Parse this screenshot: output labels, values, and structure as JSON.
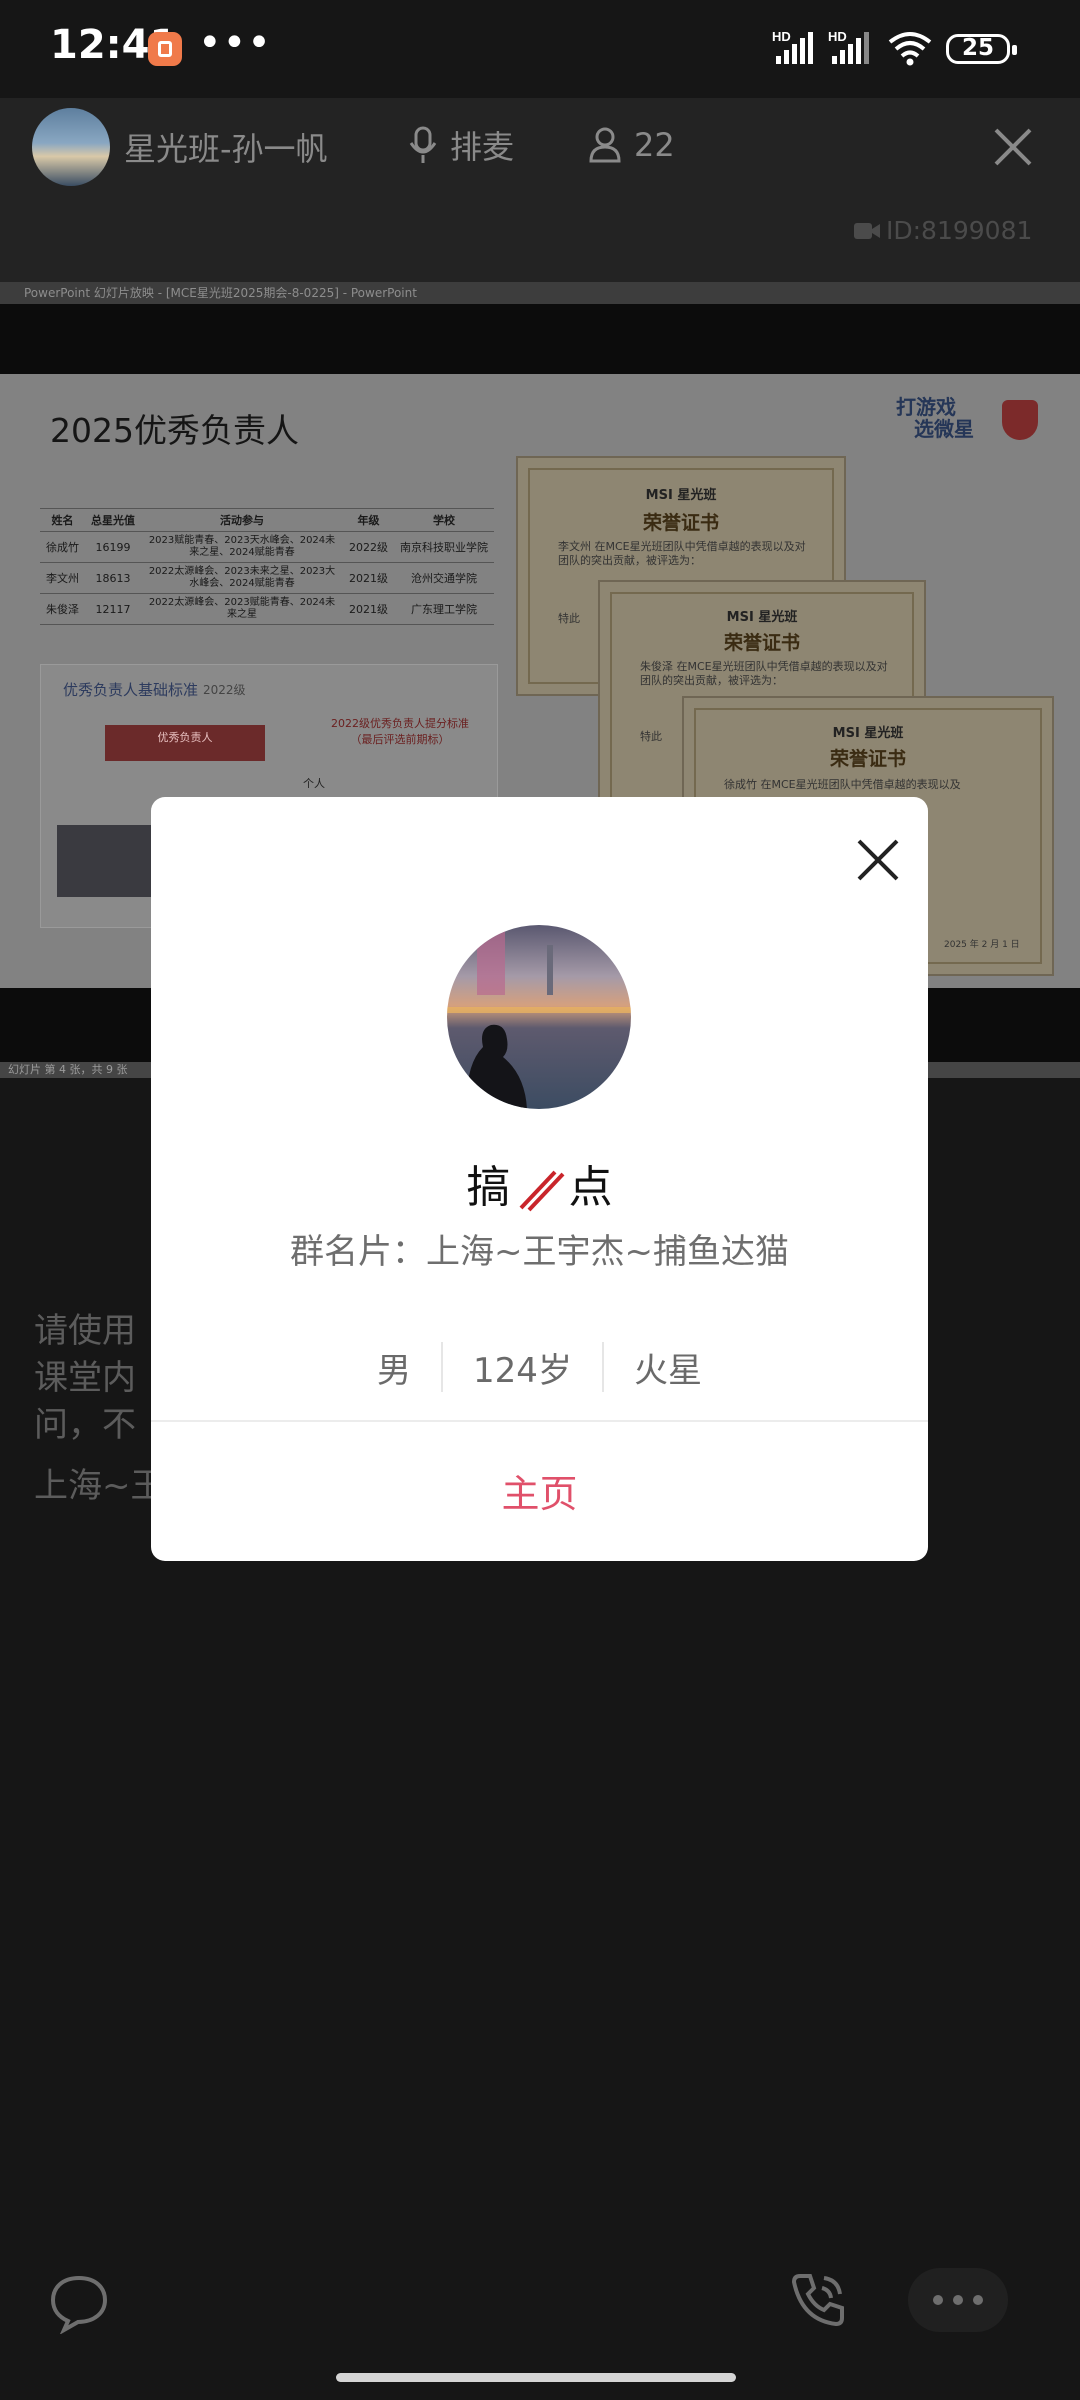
{
  "status_bar": {
    "time": "12:41",
    "dots": "•••",
    "hd1": "HD",
    "hd2": "HD",
    "battery": "25"
  },
  "header": {
    "host_name": "星光班-孙一帆",
    "queue_label": "排麦",
    "member_count": "22",
    "room_id": "ID:8199081"
  },
  "slide": {
    "window_title": "PowerPoint 幻灯片放映 - [MCE星光班2025期会-8-0225] - PowerPoint",
    "footer": "幻灯片 第 4 张，共 9 张",
    "title": "2025优秀负责人",
    "logo_text": [
      "打游戏",
      "选微星"
    ],
    "table": {
      "headers": [
        "姓名",
        "总星光值",
        "活动参与",
        "年级",
        "学校"
      ],
      "rows": [
        [
          "徐成竹",
          "16199",
          "2023赋能青春、2023天水峰会、2024未来之星、2024赋能青春",
          "2022级",
          "南京科技职业学院"
        ],
        [
          "李文州",
          "18613",
          "2022太源峰会、2023未来之星、2023大水峰会、2024赋能青春",
          "2021级",
          "沧州交通学院"
        ],
        [
          "朱俊泽",
          "12117",
          "2022太源峰会、2023赋能青春、2024未来之星",
          "2021级",
          "广东理工学院"
        ]
      ]
    },
    "criteria_title": "优秀负责人基础标准",
    "criteria_year": "2022级",
    "criteria_badge": "优秀负责人",
    "criteria_subtitle": "2022级优秀负责人提分标准",
    "criteria_subtitle2": "（最后评选前期标）",
    "criteria_item": "个人",
    "certs": [
      {
        "logo": "MSI 星光班",
        "heading": "荣誉证书",
        "body": "李文州 在MCE星光班团队中凭借卓越的表现以及对团队的突出贡献，被评选为：",
        "tail": "特此"
      },
      {
        "logo": "MSI 星光班",
        "heading": "荣誉证书",
        "body": "朱俊泽 在MCE星光班团队中凭借卓越的表现以及对团队的突出贡献，被评选为：",
        "tail": "特此"
      },
      {
        "logo": "MSI 星光班",
        "heading": "荣誉证书",
        "body": "徐成竹 在MCE星光班团队中凭借卓越的表现以及",
        "tail": "2025 年 2 月 1 日"
      }
    ]
  },
  "background_text": {
    "line1": "请使用",
    "line2": "课堂内",
    "line3": "问，不",
    "line4": "上海~王"
  },
  "profile_card": {
    "nickname_left": "搞",
    "nickname_right": "点",
    "group_card": "群名片：上海~王宇杰~捕鱼达猫",
    "gender": "男",
    "age": "124岁",
    "location": "火星",
    "home_label": "主页",
    "accent": "#e0506a"
  }
}
